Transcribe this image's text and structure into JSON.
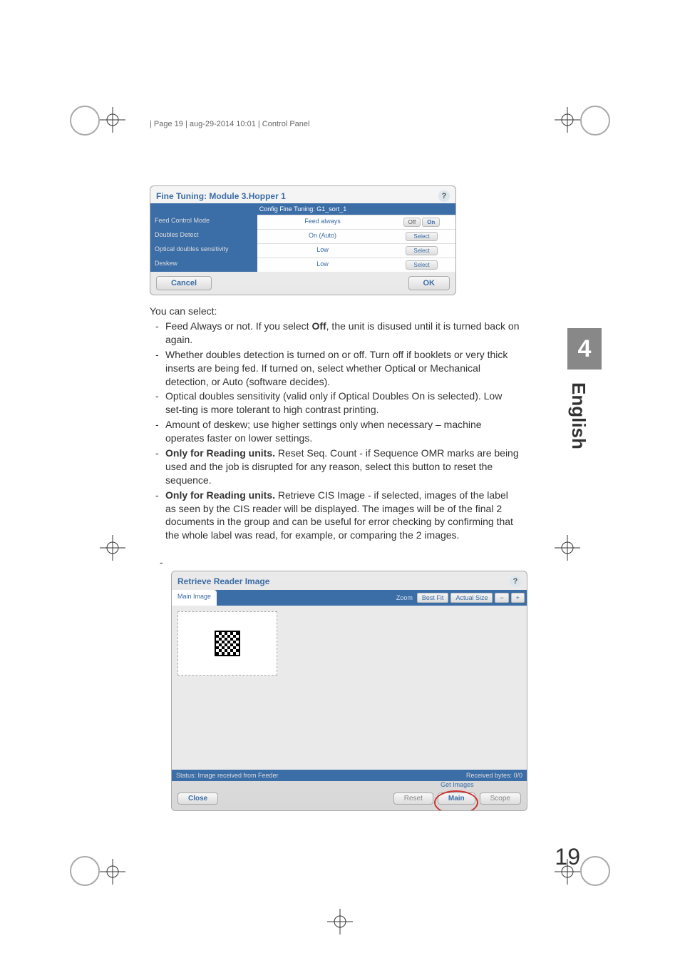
{
  "header": "| Page 19 | aug-29-2014 10:01 | Control Panel",
  "side_tab": {
    "number": "4",
    "language": "English"
  },
  "panel_fine_tuning": {
    "title": "Fine Tuning: Module 3.Hopper 1",
    "config_label": "Config Fine Tuning: G1_sort_1",
    "rows": [
      {
        "label": "Feed Control Mode",
        "value": "Feed always",
        "action_type": "toggle",
        "off": "Off",
        "on": "On"
      },
      {
        "label": "Doubles Detect",
        "value": "On (Auto)",
        "action_type": "select",
        "btn": "Select"
      },
      {
        "label": "Optical doubles sensitivity",
        "value": "Low",
        "action_type": "select",
        "btn": "Select"
      },
      {
        "label": "Deskew",
        "value": "Low",
        "action_type": "select",
        "btn": "Select"
      }
    ],
    "cancel": "Cancel",
    "ok": "OK"
  },
  "intro": "You can select:",
  "bullets": [
    {
      "pre": "Feed Always or not. If you select ",
      "bold": "Off",
      "post": ", the unit is disused until it is turned back on again."
    },
    {
      "text": "Whether doubles detection is turned on or off. Turn off if booklets or very thick inserts are being fed. If turned on, select whether Optical or Mechanical detection, or Auto (software decides)."
    },
    {
      "text": "Optical doubles sensitivity (valid only if Optical Doubles On is selected). Low set-ting is more tolerant to high contrast printing."
    },
    {
      "text": "Amount of deskew; use higher settings only when necessary – machine operates faster on lower settings."
    },
    {
      "bold_lead": "Only for Reading units.",
      "post": " Reset Seq. Count - if Sequence OMR marks are being used and the job is disrupted for any reason, select this button to reset the sequence."
    },
    {
      "bold_lead": "Only for Reading units.",
      "post": " Retrieve CIS Image - if selected, images of the label as seen by the CIS reader will be displayed. The images will be of the final 2 documents in the group and can be useful for error checking by confirming that the whole label was read, for example, or comparing the 2 images."
    }
  ],
  "reader_panel": {
    "title": "Retrieve Reader Image",
    "tab_main": "Main Image",
    "zoom_label": "Zoom",
    "best_fit": "Best Fit",
    "actual_size": "Actual Size",
    "minus": "−",
    "plus": "+",
    "status_left": "Status: Image received from Feeder",
    "status_right": "Received bytes: 0/0",
    "close": "Close",
    "get_images": "Get Images",
    "reset": "Reset",
    "main": "Main",
    "scope": "Scope"
  },
  "page_number": "19"
}
